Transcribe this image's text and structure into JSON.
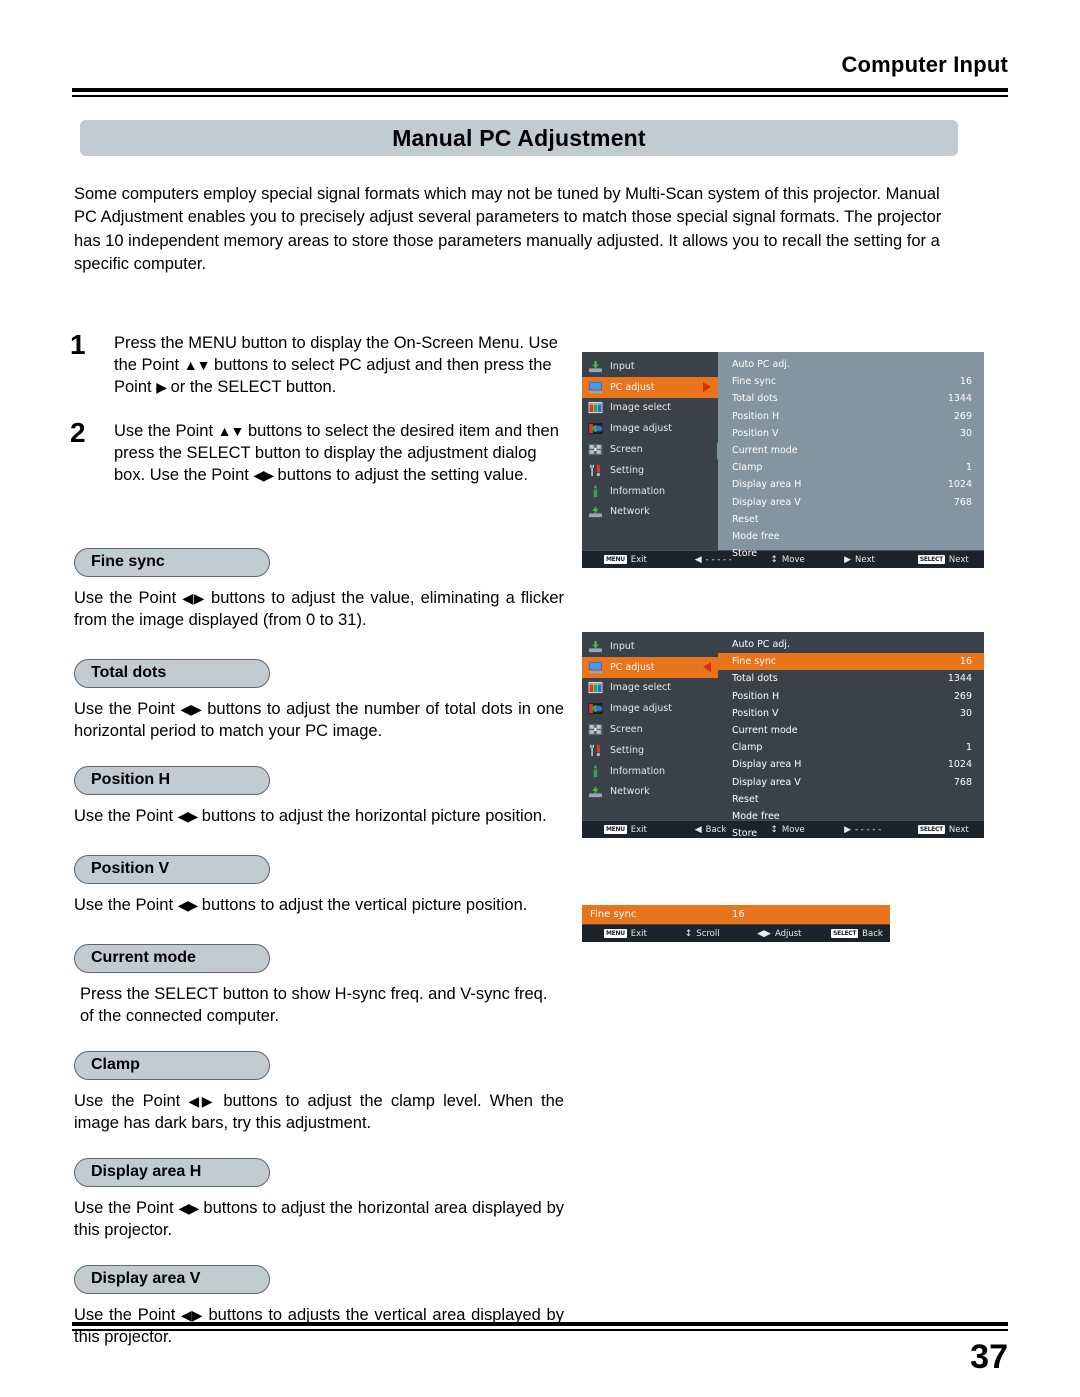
{
  "header": {
    "chapter": "Computer Input"
  },
  "title": "Manual PC Adjustment",
  "intro": "Some computers employ special signal formats which may not be tuned by Multi-Scan system of this projector. Manual PC Adjustment enables you to precisely adjust several parameters to match those special signal formats. The projector has 10 independent memory areas to store those parameters manually adjusted. It allows you to recall the setting for a specific computer.",
  "steps": [
    {
      "num": "1",
      "text_a": "Press the MENU button to display the On-Screen Menu. Use the Point ",
      "arrows_a": "▲▼",
      "text_b": " buttons to select PC adjust and then press the Point ",
      "arrows_b": "▶",
      "text_c": " or the SELECT button."
    },
    {
      "num": "2",
      "text_a": "Use the Point ",
      "arrows_a": "▲▼",
      "text_b": " buttons to select the desired item and then press the SELECT button to display the adjustment dialog box. Use the Point ",
      "arrows_b": "◀▶",
      "text_c": " buttons to adjust the setting value."
    }
  ],
  "sections": [
    {
      "label": "Fine sync",
      "pre": "Use the Point ",
      "arrows": "◀▶",
      "post": " buttons to adjust the value, eliminating a flicker from the image displayed (from 0 to 31)."
    },
    {
      "label": "Total dots",
      "pre": "Use the Point ",
      "arrows": "◀▶",
      "post": " buttons to adjust the number of total dots in one horizontal period to match your PC image."
    },
    {
      "label": "Position H",
      "pre": "Use the Point ",
      "arrows": "◀▶",
      "post": " buttons to adjust the horizontal picture position."
    },
    {
      "label": "Position V",
      "pre": "Use the Point ",
      "arrows": "◀▶",
      "post": " buttons to adjust the vertical picture position."
    },
    {
      "label": "Current mode",
      "pre": "",
      "arrows": "",
      "post": "Press the SELECT button to show H-sync freq. and V-sync freq. of  the connected computer."
    },
    {
      "label": "Clamp",
      "pre": "Use the Point ",
      "arrows": "◀▶",
      "post": " buttons to adjust the clamp level. When the image has dark bars, try this adjustment."
    },
    {
      "label": "Display area H",
      "pre": "Use the Point ",
      "arrows": "◀▶",
      "post": " buttons to adjust the horizontal area displayed by this projector."
    },
    {
      "label": "Display area V",
      "pre": "Use the Point ",
      "arrows": "◀▶",
      "post": " buttons to adjusts the vertical area displayed by this projector."
    }
  ],
  "osd": {
    "sidebar_items": [
      {
        "label": "Input",
        "icon": "input-icon"
      },
      {
        "label": "PC adjust",
        "icon": "monitor-icon"
      },
      {
        "label": "Image select",
        "icon": "image-select-icon"
      },
      {
        "label": "Image adjust",
        "icon": "image-adjust-icon"
      },
      {
        "label": "Screen",
        "icon": "screen-icon"
      },
      {
        "label": "Setting",
        "icon": "tools-icon"
      },
      {
        "label": "Information",
        "icon": "info-icon"
      },
      {
        "label": "Network",
        "icon": "network-icon"
      }
    ],
    "menu_rows": [
      {
        "label": "Auto PC adj.",
        "value": ""
      },
      {
        "label": "Fine sync",
        "value": "16"
      },
      {
        "label": "Total dots",
        "value": "1344"
      },
      {
        "label": "Position H",
        "value": "269"
      },
      {
        "label": "Position V",
        "value": "30"
      },
      {
        "label": "Current mode",
        "value": ""
      },
      {
        "label": "Clamp",
        "value": "1"
      },
      {
        "label": "Display area H",
        "value": "1024"
      },
      {
        "label": "Display area V",
        "value": "768"
      },
      {
        "label": "Reset",
        "value": ""
      },
      {
        "label": "Mode free",
        "value": ""
      },
      {
        "label": "Store",
        "value": ""
      }
    ],
    "status_top": [
      {
        "key": "MENU",
        "label": "Exit"
      },
      {
        "key": "◀",
        "label": "- - - - -"
      },
      {
        "key": "↕",
        "label": "Move"
      },
      {
        "key": "▶",
        "label": "Next"
      },
      {
        "key": "SELECT",
        "label": "Next"
      }
    ],
    "status_mid": [
      {
        "key": "MENU",
        "label": "Exit"
      },
      {
        "key": "◀",
        "label": "Back"
      },
      {
        "key": "↕",
        "label": "Move"
      },
      {
        "key": "▶",
        "label": "- - - - -"
      },
      {
        "key": "SELECT",
        "label": "Next"
      }
    ],
    "status_mini": [
      {
        "key": "MENU",
        "label": "Exit"
      },
      {
        "key": "↕",
        "label": "Scroll"
      },
      {
        "key": "◀▶",
        "label": "Adjust"
      },
      {
        "key": "SELECT",
        "label": "Back"
      }
    ],
    "mini_dialog": {
      "label": "Fine sync",
      "value": "16"
    },
    "selected_sidebar_index": 1,
    "selected_row_index": 1,
    "colors": {
      "highlight": "#e8741c",
      "sidebar_bg": "#3b4148",
      "panel_light": "#8295a0",
      "panel_dark": "#3b4148",
      "status_bg": "#1d232b",
      "caret": "#e02b12"
    }
  },
  "page_number": "37"
}
